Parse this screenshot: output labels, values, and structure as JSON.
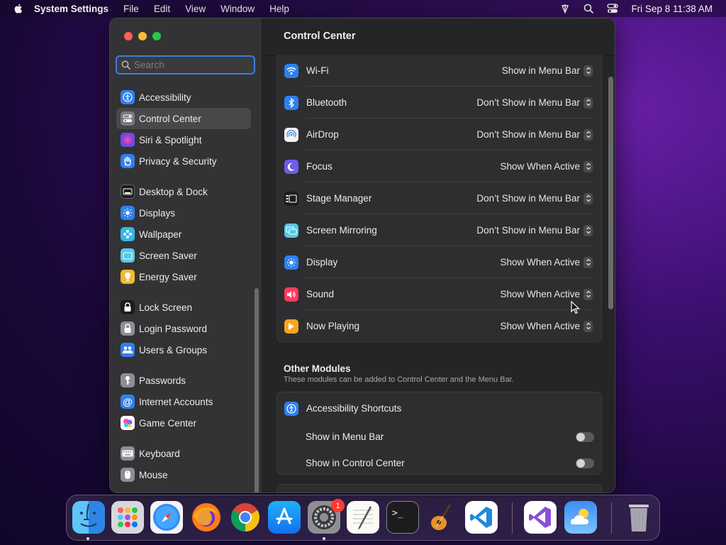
{
  "menubar": {
    "app_name": "System Settings",
    "menus": [
      "File",
      "Edit",
      "View",
      "Window",
      "Help"
    ],
    "clock": "Fri Sep 8  11:38 AM"
  },
  "search": {
    "placeholder": "Search",
    "value": ""
  },
  "sidebar": {
    "items": [
      {
        "label": "Accessibility",
        "icon": "accessibility-icon",
        "color": "#2f80ed"
      },
      {
        "label": "Control Center",
        "icon": "control-center-icon",
        "color": "#7a7a7e",
        "selected": true
      },
      {
        "label": "Siri & Spotlight",
        "icon": "siri-icon",
        "color": "#b03ee0"
      },
      {
        "label": "Privacy & Security",
        "icon": "hand-icon",
        "color": "#2f80ed"
      },
      {
        "label": "Desktop & Dock",
        "icon": "dock-icon",
        "color": "#1c1c1e"
      },
      {
        "label": "Displays",
        "icon": "sun-icon",
        "color": "#2f80ed"
      },
      {
        "label": "Wallpaper",
        "icon": "wallpaper-icon",
        "color": "#38b6e8"
      },
      {
        "label": "Screen Saver",
        "icon": "screen-saver-icon",
        "color": "#5ac8e8"
      },
      {
        "label": "Energy Saver",
        "icon": "bulb-icon",
        "color": "#f5b82e"
      },
      {
        "label": "Lock Screen",
        "icon": "lock-icon",
        "color": "#1c1c1e"
      },
      {
        "label": "Login Password",
        "icon": "padlock-icon",
        "color": "#8e8e93"
      },
      {
        "label": "Users & Groups",
        "icon": "users-icon",
        "color": "#2f80ed"
      },
      {
        "label": "Passwords",
        "icon": "key-icon",
        "color": "#8e8e93"
      },
      {
        "label": "Internet Accounts",
        "icon": "at-icon",
        "color": "#2f80ed"
      },
      {
        "label": "Game Center",
        "icon": "game-center-icon",
        "color": "#ffffff"
      },
      {
        "label": "Keyboard",
        "icon": "keyboard-icon",
        "color": "#8e8e93"
      },
      {
        "label": "Mouse",
        "icon": "mouse-icon",
        "color": "#8e8e93"
      }
    ]
  },
  "content": {
    "title": "Control Center",
    "rows": [
      {
        "label": "Wi-Fi",
        "value": "Show in Menu Bar",
        "icon": "wifi-icon",
        "color": "#2f80ed"
      },
      {
        "label": "Bluetooth",
        "value": "Don’t Show in Menu Bar",
        "icon": "bluetooth-icon",
        "color": "#2f80ed"
      },
      {
        "label": "AirDrop",
        "value": "Don’t Show in Menu Bar",
        "icon": "airdrop-icon",
        "color": "#f2f2f7"
      },
      {
        "label": "Focus",
        "value": "Show When Active",
        "icon": "moon-icon",
        "color": "#6e5ce6"
      },
      {
        "label": "Stage Manager",
        "value": "Don’t Show in Menu Bar",
        "icon": "stage-manager-icon",
        "color": "#1c1c1e"
      },
      {
        "label": "Screen Mirroring",
        "value": "Don’t Show in Menu Bar",
        "icon": "screen-mirroring-icon",
        "color": "#5ac8e8"
      },
      {
        "label": "Display",
        "value": "Show When Active",
        "icon": "display-sun-icon",
        "color": "#2f80ed"
      },
      {
        "label": "Sound",
        "value": "Show When Active",
        "icon": "speaker-icon",
        "color": "#ff3b5c"
      },
      {
        "label": "Now Playing",
        "value": "Show When Active",
        "icon": "play-icon",
        "color": "#f5a623"
      }
    ],
    "other_modules": {
      "title": "Other Modules",
      "subtitle": "These modules can be added to Control Center and the Menu Bar.",
      "module": {
        "label": "Accessibility Shortcuts",
        "icon": "accessibility-shortcuts-icon",
        "color": "#2f80ed"
      },
      "options": [
        {
          "label": "Show in Menu Bar",
          "on": false
        },
        {
          "label": "Show in Control Center",
          "on": false
        }
      ]
    }
  },
  "dock": {
    "apps": [
      {
        "name": "Finder",
        "icon": "finder-icon",
        "running": true
      },
      {
        "name": "Launchpad",
        "icon": "launchpad-icon"
      },
      {
        "name": "Safari",
        "icon": "safari-icon"
      },
      {
        "name": "Firefox",
        "icon": "firefox-icon"
      },
      {
        "name": "Chrome",
        "icon": "chrome-icon"
      },
      {
        "name": "App Store",
        "icon": "app-store-icon"
      },
      {
        "name": "System Settings",
        "icon": "system-settings-icon",
        "running": true,
        "badge": "1"
      },
      {
        "name": "TextEdit",
        "icon": "textedit-icon"
      },
      {
        "name": "Terminal",
        "icon": "terminal-icon"
      },
      {
        "name": "GarageBand",
        "icon": "garageband-icon"
      },
      {
        "name": "Visual Studio Code",
        "icon": "vscode-icon"
      },
      {
        "name": "Visual Studio",
        "icon": "visual-studio-icon"
      },
      {
        "name": "Weather",
        "icon": "weather-icon"
      },
      {
        "name": "Trash",
        "icon": "trash-icon"
      }
    ]
  }
}
